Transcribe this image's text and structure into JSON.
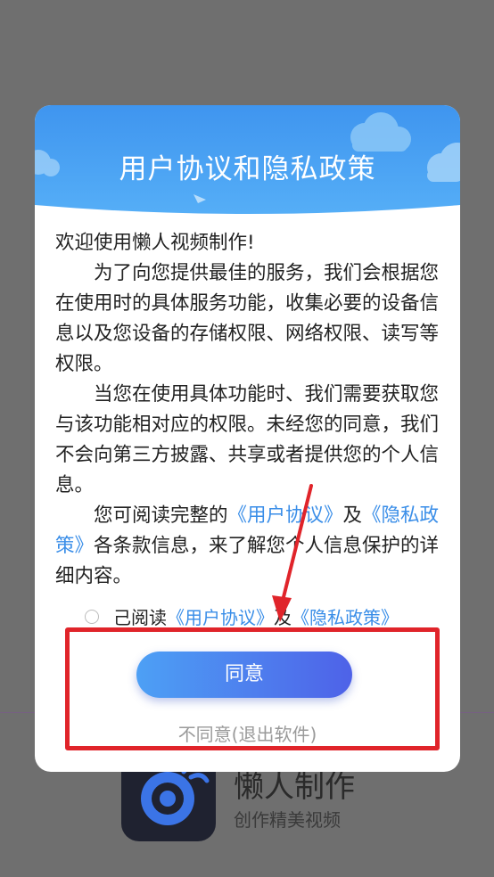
{
  "background": {
    "app_name": "懒人制作",
    "app_slogan": "创作精美视频"
  },
  "dialog": {
    "title": "用户协议和隐私政策",
    "greeting": "欢迎使用懒人视频制作!",
    "para1": "为了向您提供最佳的服务，我们会根据您在使用时的具体服务功能，收集必要的设备信息以及您设备的存储权限、网络权限、读写等权限。",
    "para2": "当您在使用具体功能时、我们需要获取您与该功能相对应的权限。未经您的同意，我们不会向第三方披露、共享或者提供您的个人信息。",
    "para3_prefix": "您可阅读完整的",
    "user_agreement_link": "《用户协议》",
    "and": "及",
    "privacy_policy_link": "《隐私政策》",
    "para3_suffix": "各条款信息，来了解您个人信息保护的详细内容。",
    "agree_row": {
      "prefix": "己阅读",
      "user_agreement": "《用户协议》",
      "and": "及",
      "privacy_policy": "《隐私政策》"
    },
    "agree_button": "同意",
    "disagree_button": "不同意(退出软件)"
  },
  "colors": {
    "accent": "#3a8ee8",
    "highlight_box": "#e0242a",
    "button_gradient_start": "#4da0f5",
    "button_gradient_end": "#4e62e8"
  }
}
